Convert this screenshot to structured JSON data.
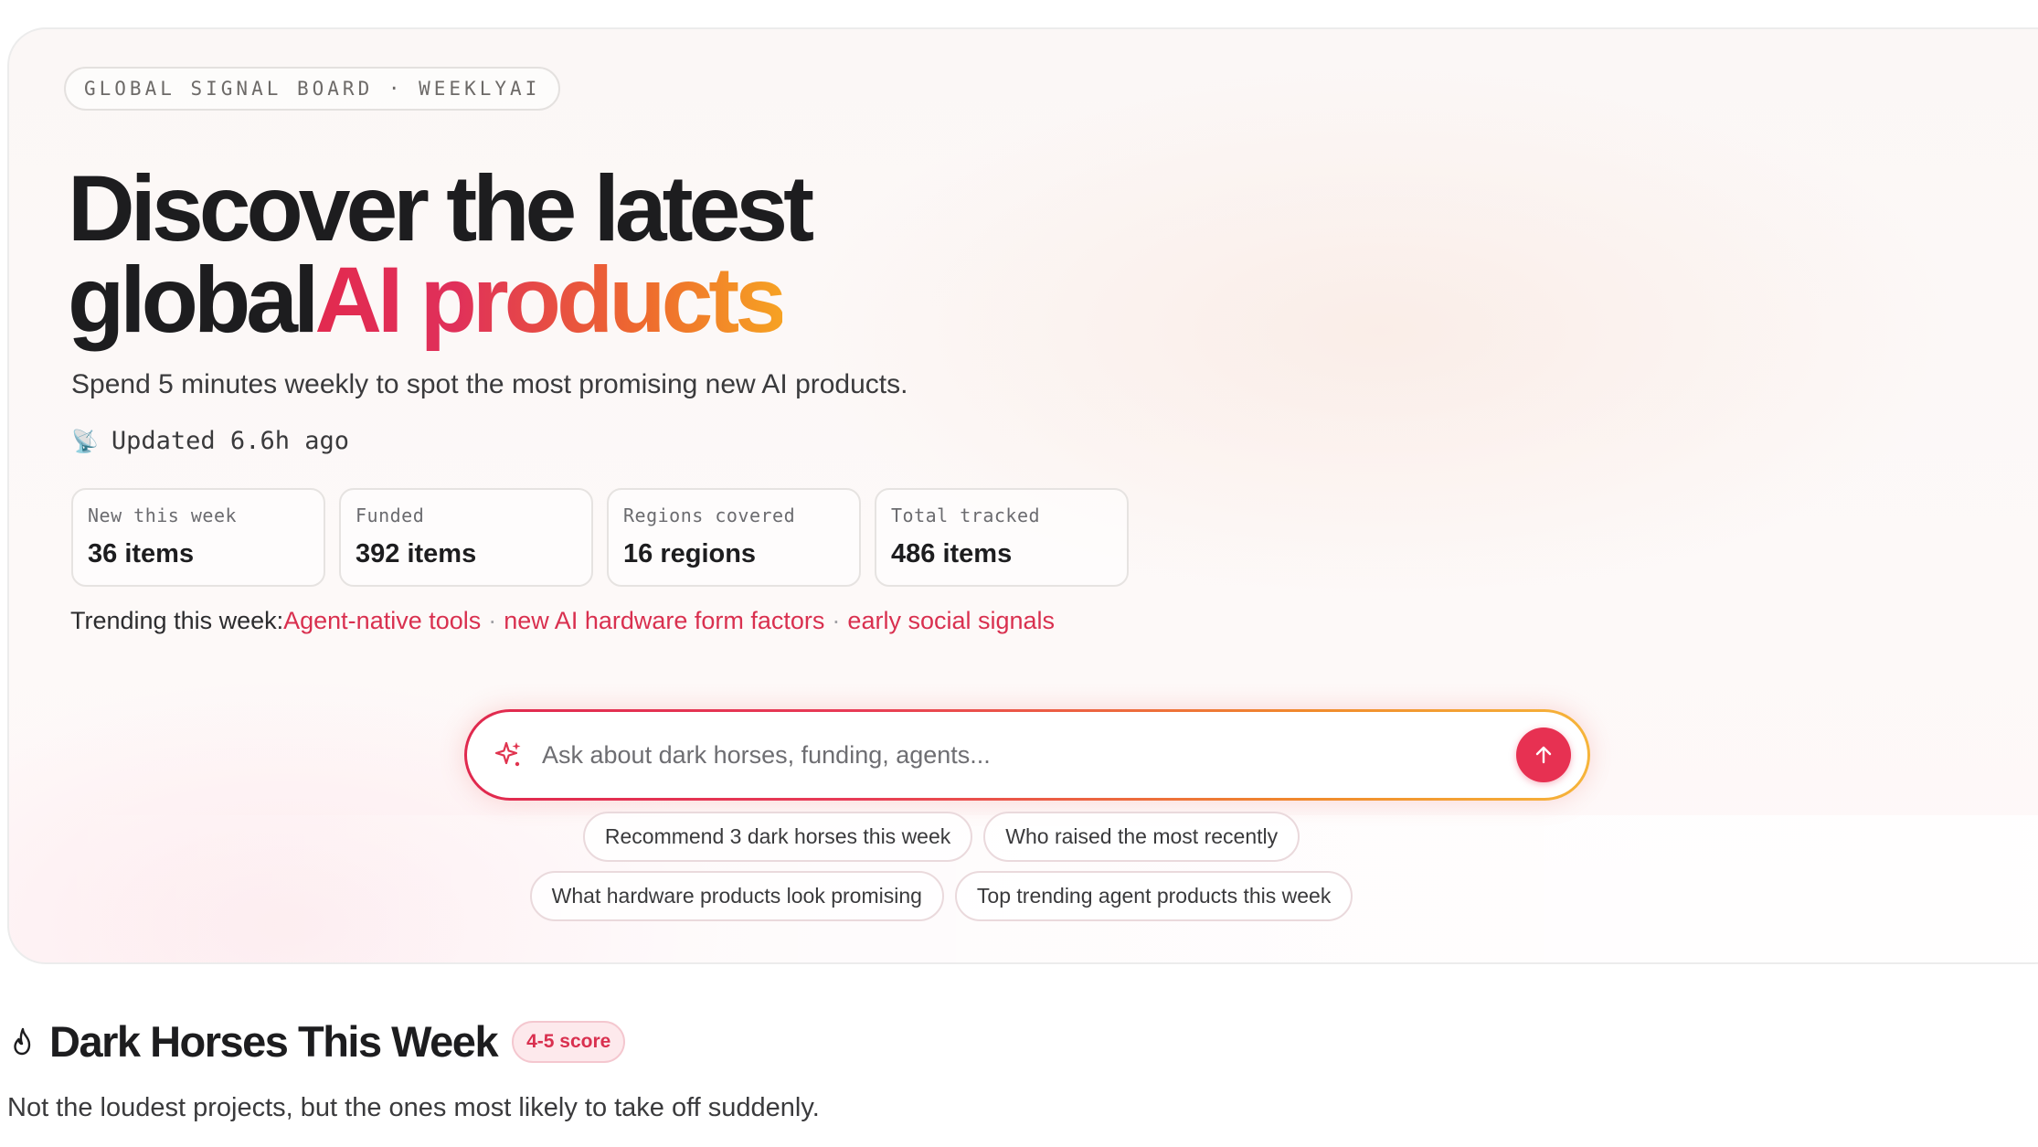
{
  "hero": {
    "tag": "GLOBAL SIGNAL BOARD · WEEKLYAI",
    "headline_line1": "Discover the latest",
    "headline_line2_plain": "global",
    "headline_line2_accent": "AI products",
    "subtitle": "Spend 5 minutes weekly to spot the most promising new AI products.",
    "updated_icon": "satellite-icon",
    "updated_text": "Updated 6.6h ago"
  },
  "stats": [
    {
      "label": "New this week",
      "value": "36 items"
    },
    {
      "label": "Funded",
      "value": "392 items"
    },
    {
      "label": "Regions covered",
      "value": "16 regions"
    },
    {
      "label": "Total tracked",
      "value": "486 items"
    }
  ],
  "trending": {
    "label": "Trending this week:",
    "topics": [
      "Agent-native tools",
      "new AI hardware form factors",
      "early social signals"
    ],
    "separator": "·"
  },
  "search": {
    "placeholder": "Ask about dark horses, funding, agents...",
    "icon": "sparkle-icon",
    "submit_icon": "arrow-up-icon"
  },
  "suggestions": {
    "row1": [
      "Recommend 3 dark horses this week",
      "Who raised the most recently"
    ],
    "row2": [
      "What hardware products look promising",
      "Top trending agent products this week"
    ]
  },
  "section": {
    "icon": "flame-icon",
    "title": "Dark Horses This Week",
    "badge": "4-5 score",
    "description": "Not the loudest projects, but the ones most likely to take off suddenly."
  },
  "colors": {
    "accent": "#e22a4f",
    "accent_orange": "#f6a223",
    "topic_link": "#d9304f"
  }
}
